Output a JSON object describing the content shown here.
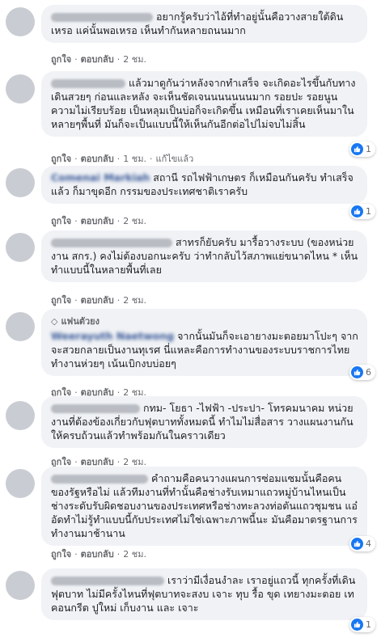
{
  "actions": {
    "like": "ถูกใจ",
    "reply": "ตอบกลับ",
    "edited": "แก้ไขแล้ว",
    "dot": "·"
  },
  "fan_badge": "แฟนตัวยง",
  "colors": {
    "bubble": "#f0f2f5",
    "link": "#385898",
    "like": "#1877f2",
    "meta": "#65676b"
  },
  "comments": [
    {
      "text": "อยากรู้ครับว่าไอ้ที่ทำอยู่นั้นคือวางสายใต้ดิน เหรอ แค่นั้นพอเหรอ เห็นทำกันหลายถนนมาก",
      "time": "2 ชม."
    },
    {
      "text": "แล้วมาดูกันว่าหลังจากทำเสร็จ จะเกิดอะไรขึ้นกับทางเดินสวยๆ ก่อนและหลัง จะเห็นชัดเจนนนนนนนมาก รอยปะ รอยนูน ความไม่เรียบร้อย เป็นหลุมเป็นบ่อก็จะเกิดขึ้น เหมือนที่เราเคยเห็นมาในหลายๆพื้นที่ มันก็จะเป็นแบบนี้ให้เห็นกันอีกต่อไปไม่จบไม่สิ้น",
      "time": "1 ชม.",
      "reactions": "1"
    },
    {
      "name": "Comenai Markiah",
      "text": "สถานี รถไฟฟ้าเกษตร ก็เหมือนกันครับ ทำเสร็จแล้ว ก็มาขุดอีก กรรมของประเทศชาติเราครับ",
      "time": "2 ชม.",
      "reactions": "1"
    },
    {
      "text": "สาทรก็ยับครับ มารื้อวางระบบ (ของหน่วยงาน สกร.) คงไม่ต้องบอกนะครับ ว่าทำกลับไว้สภาพแย่ขนาดไหน * เห็นทำแบบนี้ในหลายพื้นที่เลย",
      "time": "2 ชม."
    },
    {
      "name": "Weerayuth Naetwong",
      "text": "จากนั้นมันก็จะเอายางมะตอยมาโปะๆ จากจะสวยกลายเป็นงานทุเรศ นี่แหละคือการทำงานของระบบราชการไทย ทำงานห่วยๆ เน้นเบิกงบบ่อยๆ",
      "time": "2 ชม.",
      "reactions": "6"
    },
    {
      "text": "กทม- โยธา -ไฟฟ้า -ประปา- โทรคมนาคม หน่วยงานที่ต้องข้องเกี่ยวกับฟุตบาททั้งหมดนี้ ทำไมไม่สื่อสาร วางแผนงานกันให้ครบถ้วนแล้วทำพร้อมกันในคราวเดียว",
      "time": "2 ชม."
    },
    {
      "text": "คำถามคือคนวางแผนการซ่อมแซมนั้นคือคนของรัฐหรือไม่ แล้วทีมงานที่ทำนั้นคือช่างรับเหมาแถวหมู่บ้านไหนเป็นช่างระดับรับผิดชอบงานของประเทศหรือช่างทะลวงท่อตันแถวชุมชน แอ๋อัดทำไม่รู้ทำแบบนี้กับประเทศไม่ใช่เฉพาะภาพนี้นะ มันคือมาตรฐานการทำงานมาช้านาน",
      "time": "2 ชม.",
      "reactions": "4"
    },
    {
      "text": "เราว่ามีเงื่อนงำละ เราอยู่แถวนี้ ทุกครั้งที่เดินฟุตบาท ไม่มีครั้งไหนที่ฟุตบาทจะสงบ เจาะ ทุบ รื้อ ขุด เทยางมะตอย เทคอนกรีต ปูใหม่ เก็บงาน และ เจาะ",
      "time": "2 ชม.",
      "reactions": "1"
    }
  ]
}
